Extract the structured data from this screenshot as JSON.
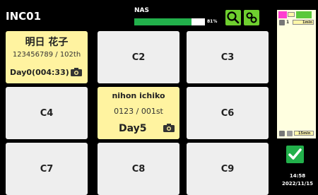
{
  "header": {
    "title": "INC01",
    "nas_label": "NAS",
    "nas_percent_text": "81%",
    "nas_usage_fraction": 0.81,
    "search_icon": "search-icon",
    "settings_icon": "link-icon"
  },
  "grid": {
    "c1": {
      "name": "明日 花子",
      "id": "123456789 / 102th",
      "day": "Day0(004:33)"
    },
    "c2": {
      "label": "C2"
    },
    "c3": {
      "label": "C3"
    },
    "c4": {
      "label": "C4"
    },
    "c5": {
      "name": "nihon ichiko",
      "id": "0123 / 001st",
      "day": "Day5"
    },
    "c6": {
      "label": "C6"
    },
    "c7": {
      "label": "C7"
    },
    "c8": {
      "label": "C8"
    },
    "c9": {
      "label": "C9"
    }
  },
  "sidebar": {
    "top_badge": "1",
    "top_time": "1min",
    "bottom_time": "15min"
  },
  "status": {
    "time": "14:58",
    "date": "2022/11/15"
  },
  "colors": {
    "occupied": "#fff3a0",
    "empty": "#eeeeee",
    "accent_green": "#6fcf2f",
    "nas_green": "#22b04b"
  }
}
